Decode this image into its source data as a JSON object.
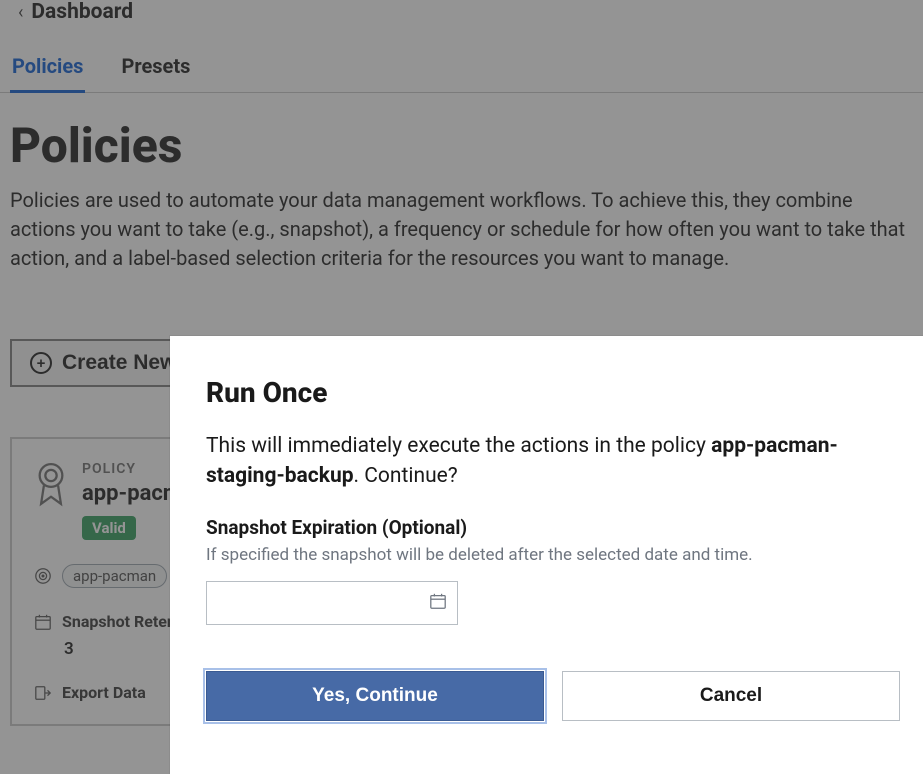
{
  "breadcrumb": {
    "back_icon": "‹",
    "label": "Dashboard"
  },
  "tabs": [
    {
      "label": "Policies",
      "active": true
    },
    {
      "label": "Presets",
      "active": false
    }
  ],
  "page": {
    "title": "Policies",
    "description": "Policies are used to automate your data management workflows. To achieve this, they combine actions you want to take (e.g., snapshot), a frequency or schedule for how often you want to take that action, and a label-based selection criteria for the resources you want to manage."
  },
  "toolbar": {
    "create_label": "Create New Policy"
  },
  "policy_card": {
    "section_label": "POLICY",
    "name": "app-pacman-staging-backup",
    "status": "Valid",
    "app_chip": "app-pacman",
    "snap_label": "Snapshot Retention",
    "snap_value": "3",
    "export_label": "Export Data"
  },
  "modal": {
    "title": "Run Once",
    "text_prefix": "This will immediately execute the actions in the policy ",
    "policy_name": "app-pacman-staging-backup",
    "text_suffix": ". Continue?",
    "field_label": "Snapshot Expiration (Optional)",
    "field_help": "If specified the snapshot will be deleted after the selected date and time.",
    "date_value": "",
    "confirm_label": "Yes, Continue",
    "cancel_label": "Cancel"
  }
}
